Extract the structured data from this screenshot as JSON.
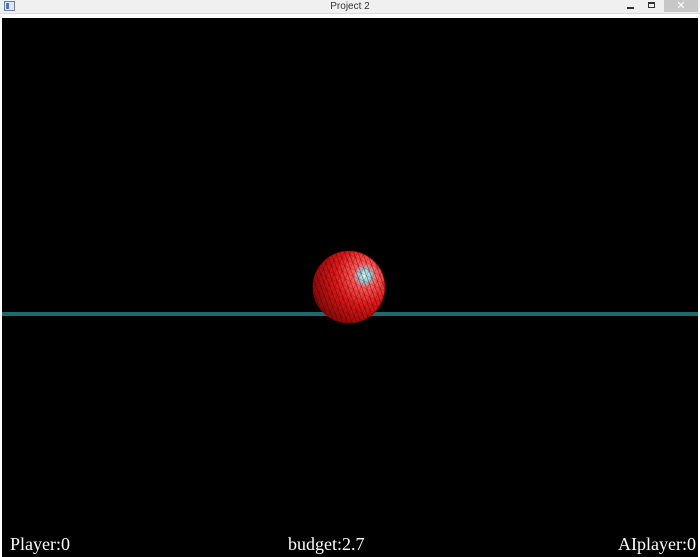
{
  "window": {
    "title": "Project 2",
    "controls": {
      "close_glyph": "✕"
    }
  },
  "scene": {
    "ball_color": "#e01818",
    "ball_highlight": "#dff6ff",
    "ground_color": "#1e6b6b",
    "background": "#000000"
  },
  "hud": {
    "player": "Player:0",
    "budget": "budget:2.7",
    "ai_player": "AIplayer:0"
  }
}
